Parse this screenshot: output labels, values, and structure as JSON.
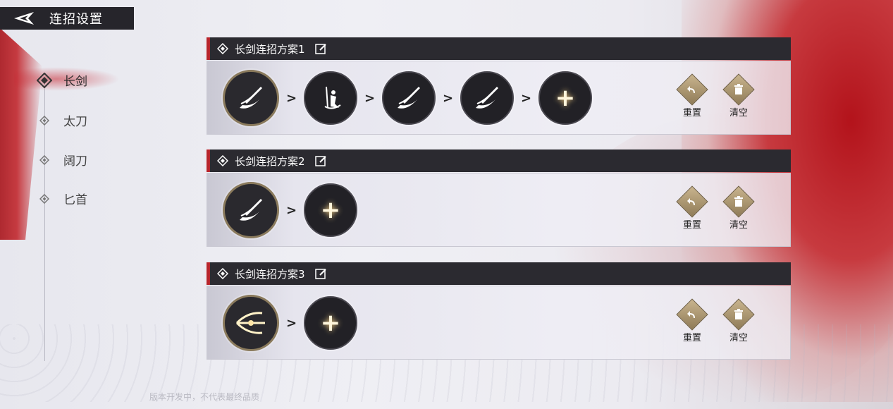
{
  "header": {
    "title": "连招设置",
    "back_icon": "back-arrow-icon"
  },
  "nav": {
    "items": [
      {
        "label": "长剑",
        "active": true
      },
      {
        "label": "太刀",
        "active": false
      },
      {
        "label": "阔刀",
        "active": false
      },
      {
        "label": "匕首",
        "active": false
      }
    ]
  },
  "schemes": [
    {
      "title": "长剑连招方案1",
      "slots": [
        "sword-slash-icon",
        "figure-strike-icon",
        "sword-slash-icon",
        "sword-slash-icon"
      ],
      "add": "+"
    },
    {
      "title": "长剑连招方案2",
      "slots": [
        "sword-slash-icon"
      ],
      "add": "+"
    },
    {
      "title": "长剑连招方案3",
      "slots": [
        "triple-slash-icon"
      ],
      "add": "+"
    }
  ],
  "actions": {
    "reset": "重置",
    "clear": "清空"
  },
  "footer": {
    "notice": "版本开发中，不代表最终品质"
  },
  "colors": {
    "header_bg": "#2b2a30",
    "accent_red": "#b7252b",
    "gold": "#c9b48e"
  }
}
